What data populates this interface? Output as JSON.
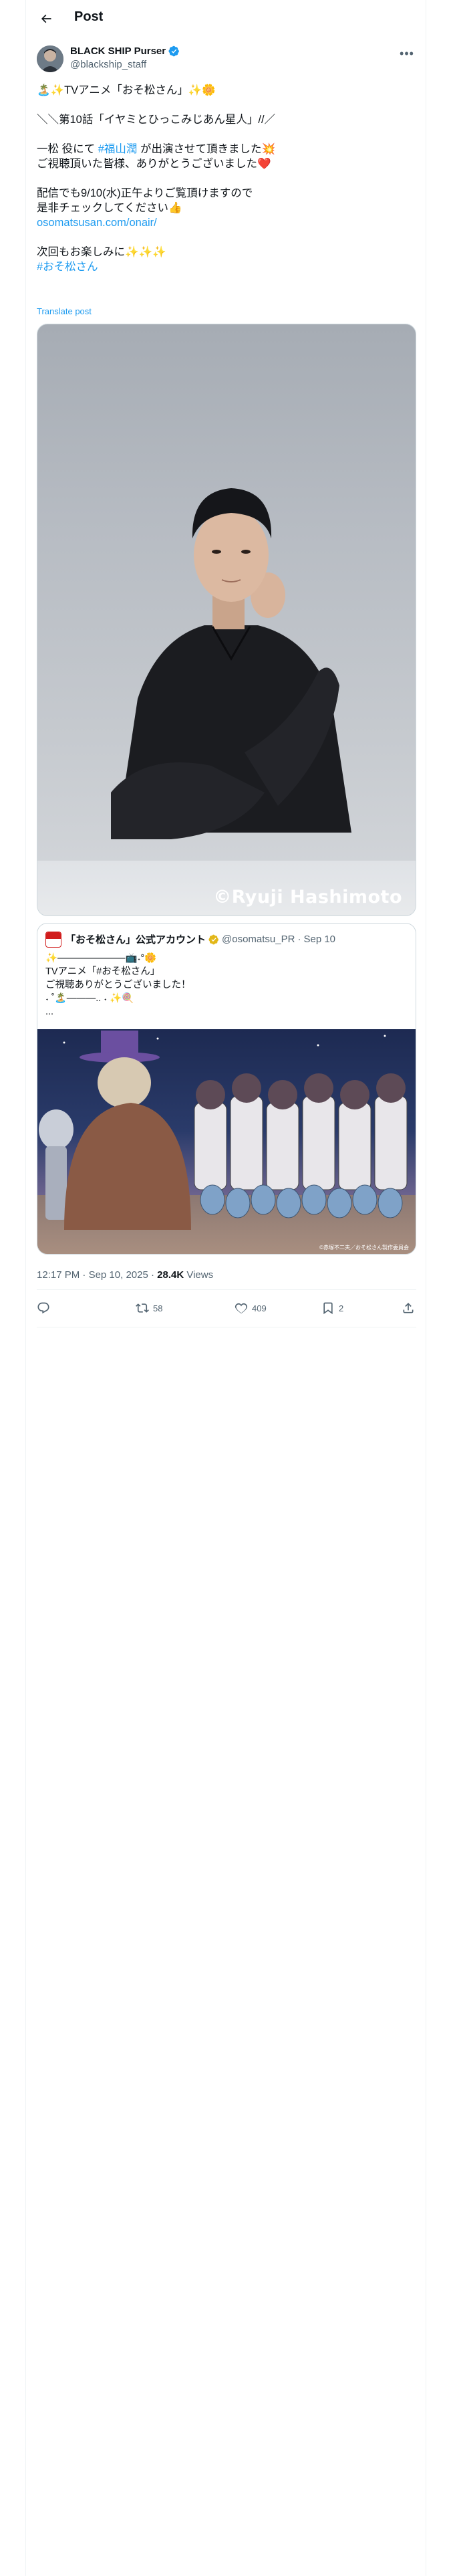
{
  "header": {
    "title": "Post"
  },
  "author": {
    "name": "BLACK SHIP Purser",
    "handle": "@blackship_staff"
  },
  "tweet": {
    "lines": [
      "🏝️✨TVアニメ「おそ松さん」✨🌼",
      "",
      "＼＼第10話「イヤミとひっこみじあん星人」//／",
      "",
      "一松 役にて",
      "ご視聴頂いた皆様、ありがとうございました❤️",
      "",
      "配信でも9/10(水)正午よりご覧頂けますので",
      "是非チェックしてください👍",
      "osomatsusan.com/onair/",
      "",
      "次回もお楽しみに✨✨✨",
      "#おそ松さん"
    ],
    "line5_suffix": "が出演させて頂きました💥",
    "hashtag_fukuyama": "#福山潤",
    "translate_label": "Translate post"
  },
  "photo": {
    "watermark": "©Ryuji Hashimoto"
  },
  "quote": {
    "name": "「おそ松さん」公式アカウント",
    "handle": "@osomatsu_PR",
    "date": "Sep 10",
    "separator": "·",
    "lines": [
      "✨———————📺˖°🌼",
      "TVアニメ「#おそ松さん」",
      "ご視聴ありがとうございました！",
      "˖ ˚🏝️———.. ˖ ✨🍭",
      "..."
    ],
    "image_copyright": "©赤塚不二夫／おそ松さん製作委員会"
  },
  "meta": {
    "time": "12:17 PM",
    "date": "Sep 10, 2025",
    "separator": "·",
    "views_count": "28.4K",
    "views_label": "Views"
  },
  "actions": {
    "reply_count": "",
    "repost_count": "58",
    "like_count": "409",
    "bookmark_count": "2"
  },
  "colors": {
    "accent": "#1d9bf0",
    "muted": "#536471",
    "border": "#cfd9de"
  }
}
